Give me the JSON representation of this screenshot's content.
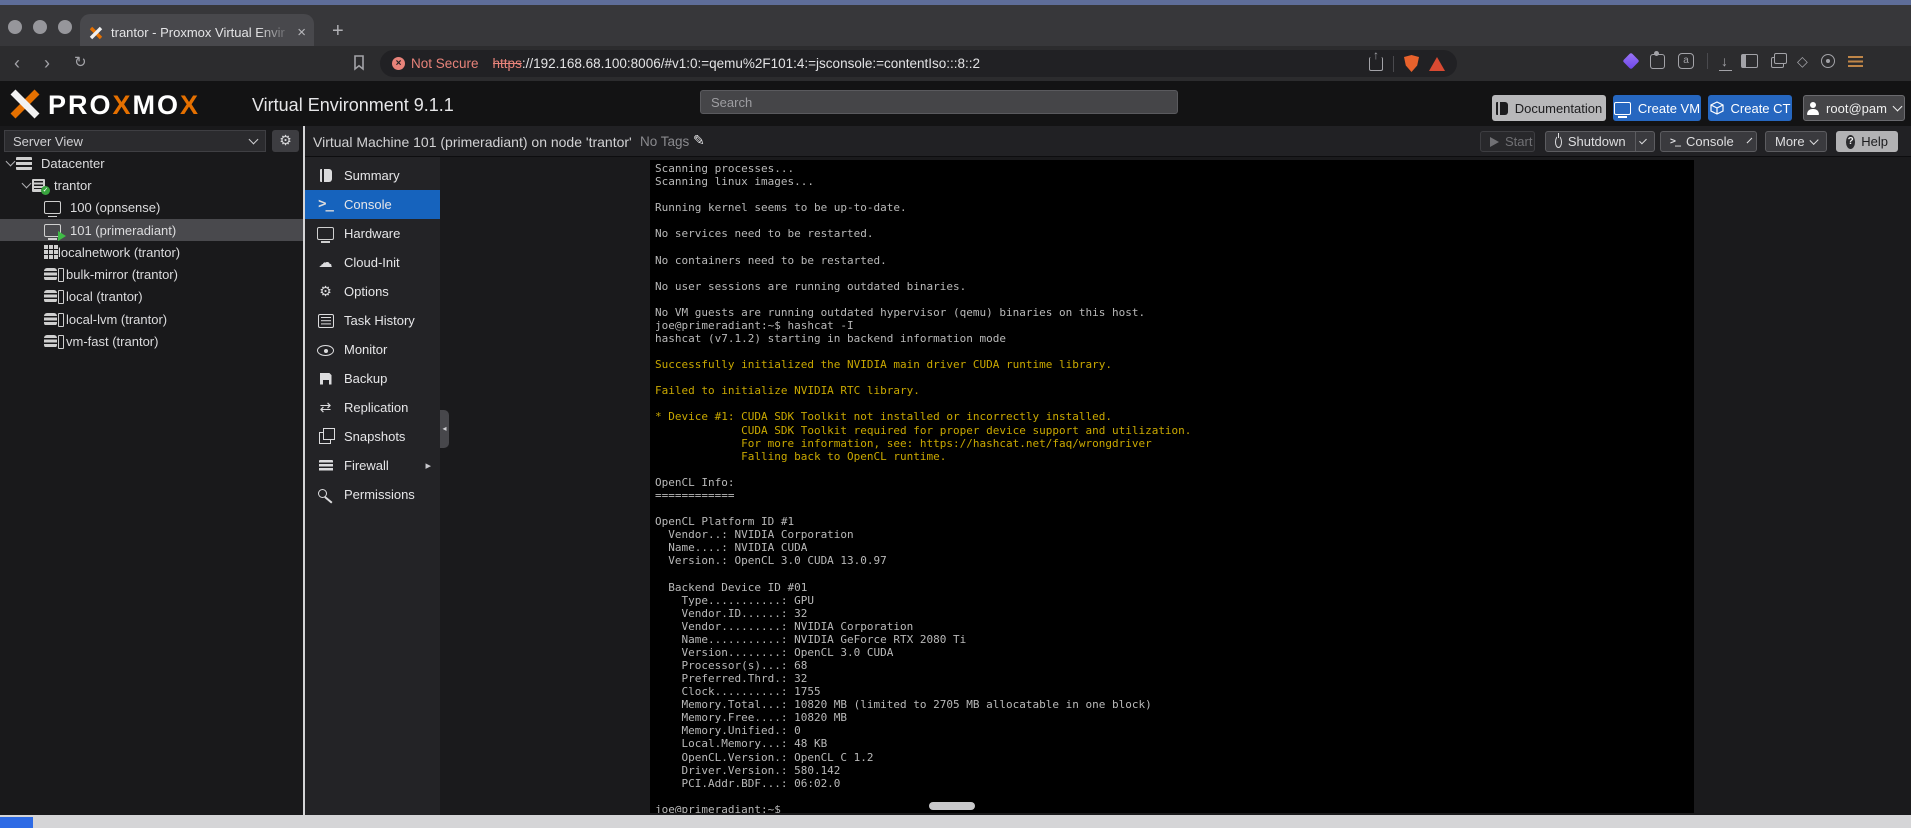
{
  "browser": {
    "tab_title": "trantor - Proxmox Virtual Envir",
    "url_badge": "Not Secure",
    "url_scheme": "https",
    "url_rest": "://192.168.68.100:8006/#v1:0:=qemu%2F101:4:=jsconsole:=contentIso:::8::2"
  },
  "icons": {
    "plus": "+",
    "back": "‹",
    "forward": "›",
    "reload": "↻",
    "close": "×",
    "badge_x": "×",
    "download": "↓",
    "diamond": "◇",
    "pencil": "✎",
    "gear": "⚙",
    "cloud": "☁",
    "replication": "⇄",
    "caret": "▸",
    "collapse": "◂",
    "prompt": ">_",
    "question": "?"
  },
  "pve_header": {
    "brand_parts": [
      {
        "t": "PRO",
        "accent": false
      },
      {
        "t": "X",
        "accent": true
      },
      {
        "t": "MO",
        "accent": false
      },
      {
        "t": "X",
        "accent": true
      }
    ],
    "subtitle": "Virtual Environment 9.1.1",
    "search_placeholder": "Search",
    "documentation_label": "Documentation",
    "create_vm_label": "Create VM",
    "create_ct_label": "Create CT",
    "user_label": "root@pam"
  },
  "toolbar": {
    "title": "Virtual Machine 101 (primeradiant) on node 'trantor'",
    "tags_label": "No Tags",
    "start_label": "Start",
    "shutdown_label": "Shutdown",
    "console_label": "Console",
    "more_label": "More",
    "help_label": "Help"
  },
  "sidebar": {
    "view_label": "Server View",
    "tree": [
      {
        "label": "Datacenter",
        "icon": "server",
        "level": 0,
        "expanded": true,
        "selected": false
      },
      {
        "label": "trantor",
        "icon": "node",
        "level": 1,
        "expanded": true,
        "selected": false
      },
      {
        "label": "100 (opnsense)",
        "icon": "vm",
        "level": 2,
        "expanded": null,
        "selected": false
      },
      {
        "label": "101 (primeradiant)",
        "icon": "vm-running",
        "level": 2,
        "expanded": null,
        "selected": true
      },
      {
        "label": "localnetwork (trantor)",
        "icon": "network",
        "level": 2,
        "expanded": null,
        "selected": false
      },
      {
        "label": "bulk-mirror (trantor)",
        "icon": "storage",
        "level": 2,
        "expanded": null,
        "selected": false
      },
      {
        "label": "local (trantor)",
        "icon": "storage",
        "level": 2,
        "expanded": null,
        "selected": false
      },
      {
        "label": "local-lvm (trantor)",
        "icon": "storage",
        "level": 2,
        "expanded": null,
        "selected": false
      },
      {
        "label": "vm-fast (trantor)",
        "icon": "storage",
        "level": 2,
        "expanded": null,
        "selected": false
      }
    ]
  },
  "vm_menu": {
    "items": [
      {
        "label": "Summary",
        "icon": "book",
        "selected": false,
        "submenu": false
      },
      {
        "label": "Console",
        "icon": "terminal",
        "selected": true,
        "submenu": false
      },
      {
        "label": "Hardware",
        "icon": "monitor",
        "selected": false,
        "submenu": false
      },
      {
        "label": "Cloud-Init",
        "icon": "cloud",
        "selected": false,
        "submenu": false
      },
      {
        "label": "Options",
        "icon": "gear",
        "selected": false,
        "submenu": false
      },
      {
        "label": "Task History",
        "icon": "list",
        "selected": false,
        "submenu": false
      },
      {
        "label": "Monitor",
        "icon": "eye",
        "selected": false,
        "submenu": false
      },
      {
        "label": "Backup",
        "icon": "floppy",
        "selected": false,
        "submenu": false
      },
      {
        "label": "Replication",
        "icon": "replication",
        "selected": false,
        "submenu": false
      },
      {
        "label": "Snapshots",
        "icon": "layers",
        "selected": false,
        "submenu": false
      },
      {
        "label": "Firewall",
        "icon": "wall",
        "selected": false,
        "submenu": true
      },
      {
        "label": "Permissions",
        "icon": "key",
        "selected": false,
        "submenu": false
      }
    ]
  },
  "console": {
    "lines": [
      {
        "c": "g",
        "t": "Scanning processes..."
      },
      {
        "c": "g",
        "t": "Scanning linux images..."
      },
      {
        "c": "g",
        "t": ""
      },
      {
        "c": "g",
        "t": "Running kernel seems to be up-to-date."
      },
      {
        "c": "g",
        "t": ""
      },
      {
        "c": "g",
        "t": "No services need to be restarted."
      },
      {
        "c": "g",
        "t": ""
      },
      {
        "c": "g",
        "t": "No containers need to be restarted."
      },
      {
        "c": "g",
        "t": ""
      },
      {
        "c": "g",
        "t": "No user sessions are running outdated binaries."
      },
      {
        "c": "g",
        "t": ""
      },
      {
        "c": "g",
        "t": "No VM guests are running outdated hypervisor (qemu) binaries on this host."
      },
      {
        "c": "g",
        "t": "joe@primeradiant:~$ hashcat -I"
      },
      {
        "c": "g",
        "t": "hashcat (v7.1.2) starting in backend information mode"
      },
      {
        "c": "g",
        "t": ""
      },
      {
        "c": "y",
        "t": "Successfully initialized the NVIDIA main driver CUDA runtime library."
      },
      {
        "c": "g",
        "t": ""
      },
      {
        "c": "y",
        "t": "Failed to initialize NVIDIA RTC library."
      },
      {
        "c": "g",
        "t": ""
      },
      {
        "c": "y",
        "t": "* Device #1: CUDA SDK Toolkit not installed or incorrectly installed."
      },
      {
        "c": "y",
        "t": "             CUDA SDK Toolkit required for proper device support and utilization."
      },
      {
        "c": "y",
        "t": "             For more information, see: https://hashcat.net/faq/wrongdriver"
      },
      {
        "c": "y",
        "t": "             Falling back to OpenCL runtime."
      },
      {
        "c": "g",
        "t": ""
      },
      {
        "c": "g",
        "t": "OpenCL Info:"
      },
      {
        "c": "g",
        "t": "============"
      },
      {
        "c": "g",
        "t": ""
      },
      {
        "c": "g",
        "t": "OpenCL Platform ID #1"
      },
      {
        "c": "g",
        "t": "  Vendor..: NVIDIA Corporation"
      },
      {
        "c": "g",
        "t": "  Name....: NVIDIA CUDA"
      },
      {
        "c": "g",
        "t": "  Version.: OpenCL 3.0 CUDA 13.0.97"
      },
      {
        "c": "g",
        "t": ""
      },
      {
        "c": "g",
        "t": "  Backend Device ID #01"
      },
      {
        "c": "g",
        "t": "    Type...........: GPU"
      },
      {
        "c": "g",
        "t": "    Vendor.ID......: 32"
      },
      {
        "c": "g",
        "t": "    Vendor.........: NVIDIA Corporation"
      },
      {
        "c": "g",
        "t": "    Name...........: NVIDIA GeForce RTX 2080 Ti"
      },
      {
        "c": "g",
        "t": "    Version........: OpenCL 3.0 CUDA"
      },
      {
        "c": "g",
        "t": "    Processor(s)...: 68"
      },
      {
        "c": "g",
        "t": "    Preferred.Thrd.: 32"
      },
      {
        "c": "g",
        "t": "    Clock..........: 1755"
      },
      {
        "c": "g",
        "t": "    Memory.Total...: 10820 MB (limited to 2705 MB allocatable in one block)"
      },
      {
        "c": "g",
        "t": "    Memory.Free....: 10820 MB"
      },
      {
        "c": "g",
        "t": "    Memory.Unified.: 0"
      },
      {
        "c": "g",
        "t": "    Local.Memory...: 48 KB"
      },
      {
        "c": "g",
        "t": "    OpenCL.Version.: OpenCL C 1.2"
      },
      {
        "c": "g",
        "t": "    Driver.Version.: 580.142"
      },
      {
        "c": "g",
        "t": "    PCI.Addr.BDF...: 06:02.0"
      },
      {
        "c": "g",
        "t": ""
      },
      {
        "c": "g",
        "t": "joe@primeradiant:~$ "
      }
    ]
  },
  "colors": {
    "brand_orange": "#e57000",
    "button_blue": "#2667c0",
    "menu_selection_blue": "#1663bd",
    "terminal_yellow": "#c9a800",
    "terminal_gray": "#b9b9b9",
    "not_secure_red": "#e8837a"
  }
}
